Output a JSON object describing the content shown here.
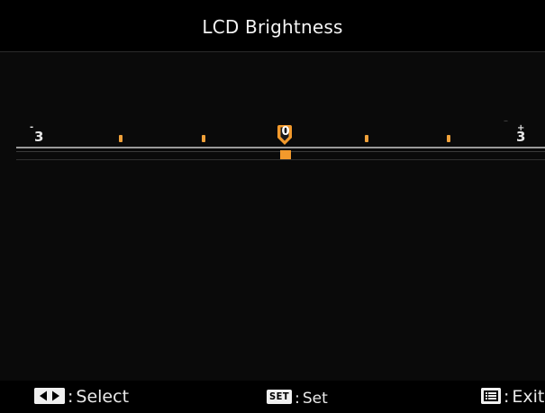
{
  "header": {
    "title": "LCD Brightness"
  },
  "scale": {
    "min_label": "3",
    "min_sign": "-",
    "max_label": "3",
    "max_sign": "+",
    "current_value": "0",
    "level": 0,
    "range": [
      -3,
      3
    ]
  },
  "footer": {
    "select_label": "Select",
    "set_key": "SET",
    "set_label": "Set",
    "exit_label": "Exit"
  },
  "colors": {
    "accent": "#f39a2c",
    "tick": "#f0a13a",
    "background": "#0a0a0a",
    "text": "#f2f2f2"
  },
  "icons": {
    "select": "left-right-arrows-icon",
    "set": "set-button-icon",
    "exit": "menu-button-icon"
  }
}
